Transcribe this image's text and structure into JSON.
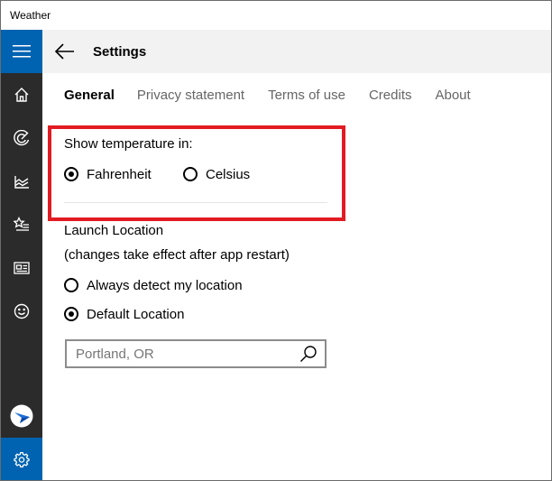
{
  "window": {
    "title": "Weather"
  },
  "rail": {
    "items": [
      {
        "icon": "hamburger-menu-icon"
      },
      {
        "icon": "home-icon"
      },
      {
        "icon": "radar-icon"
      },
      {
        "icon": "chart-icon"
      },
      {
        "icon": "favorites-icon"
      },
      {
        "icon": "news-icon"
      },
      {
        "icon": "smiley-icon"
      },
      {
        "icon": "app-logo-icon"
      },
      {
        "icon": "gear-icon"
      }
    ],
    "accent_color": "#0063b1"
  },
  "header": {
    "title": "Settings"
  },
  "tabs": [
    {
      "label": "General",
      "active": true
    },
    {
      "label": "Privacy statement",
      "active": false
    },
    {
      "label": "Terms of use",
      "active": false
    },
    {
      "label": "Credits",
      "active": false
    },
    {
      "label": "About",
      "active": false
    }
  ],
  "temperature": {
    "heading": "Show temperature in:",
    "options": [
      {
        "label": "Fahrenheit",
        "checked": true
      },
      {
        "label": "Celsius",
        "checked": false
      }
    ],
    "highlight_color": "#e21b23"
  },
  "launch": {
    "heading": "Launch Location",
    "note": "(changes take effect after app restart)",
    "options": [
      {
        "label": "Always detect my location",
        "checked": false
      },
      {
        "label": "Default Location",
        "checked": true
      }
    ],
    "search": {
      "value": "",
      "placeholder": "Portland, OR"
    }
  }
}
